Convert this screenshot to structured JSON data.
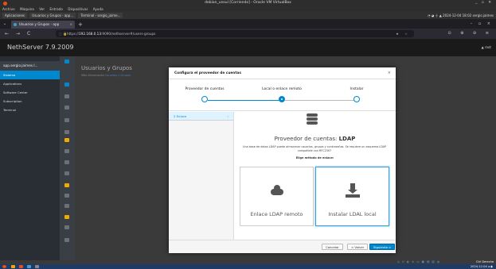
{
  "vbox": {
    "title": "debian_unsul [Corriendo] - Oracle VM VirtualBox",
    "window_controls": "_ ▫ ✕",
    "menu": [
      "Archivo",
      "Máquina",
      "Ver",
      "Entrada",
      "Dispositivos",
      "Ayuda"
    ],
    "status_right": "Ctrl Derecha",
    "status_icons": "◎ ⊙ ◐ ⊘ ▭ ▣ ▤ ▥ ◍"
  },
  "guest_panel": {
    "apps_label": "Aplicaciones",
    "task1": "Usuarios y Grupos - app...",
    "task2": "Terminal - sergio_jaime...",
    "clock_time": "2024-12-04",
    "clock_date": "18:02",
    "user": "sergio.jaimes",
    "tray_icons": "◔ ◕ ⏚ ▲"
  },
  "browser": {
    "tab_title": "Usuarios y Grupos - app",
    "url_host": "192.168.0.13",
    "url_prefix": "https://",
    "url_path": ":9090/nethserver#/users-groups",
    "nav_back": "←",
    "nav_forward": "→",
    "nav_reload": "C",
    "tab_close": "×",
    "new_tab": "+",
    "tab_list": "⌄",
    "win_controls": "– ▫ ×",
    "url_icons": "◌ 🔒",
    "url_right": "★ ☆",
    "nav_right": "⊙ ⊕ ⊘ ≡"
  },
  "nethserver": {
    "brand": "NethServer 7.9.2009",
    "user": "root",
    "app_name": "app.sergio.jaimes.l...",
    "sidebar": [
      "Sistema",
      "Applications",
      "Software Center",
      "Subscription",
      "Terminal"
    ],
    "page_title": "Usuarios y Grupos",
    "page_sub_prefix": "Más información",
    "page_sub_link": "Usuarios y Grupos"
  },
  "modal": {
    "title": "Configura el proveedor de cuentas",
    "close": "×",
    "steps": [
      "Proveedor de cuentas",
      "Local o enlace remoto",
      "Instalar"
    ],
    "active_step": 1,
    "left_item": "Enlace",
    "left_prefix": "2",
    "provider_prefix": "Proveedor de cuentas:",
    "provider_name": "LDAP",
    "description": "Una base de datos LDAP puede almacenar usuarios, grupos y contraseñas. Se requiere un esquema LDAP compatible con RFC2307",
    "choose": "Elige método de enlace:",
    "option_remote": "Enlace LDAP remoto",
    "option_local": "Instalar LDAL local",
    "btn_cancel": "Cancelar",
    "btn_back": "< Volver",
    "btn_next": "Siguiente >"
  },
  "taskbar": {
    "clock": "2024-12-04  ◂ ◉"
  },
  "colors": {
    "accent": "#0088ce",
    "header": "#1a1a1a",
    "sidebar": "#292e34",
    "warning": "#f0ab00"
  }
}
